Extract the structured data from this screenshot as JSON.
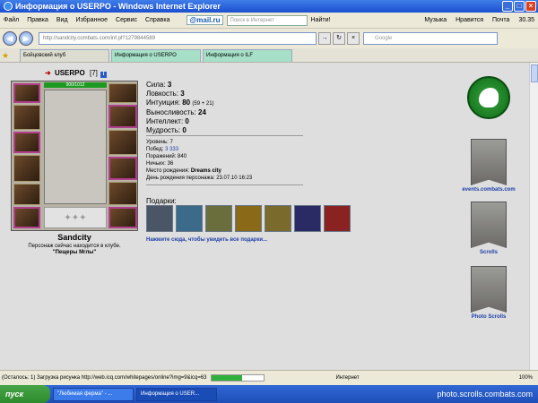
{
  "window": {
    "title": "Информация о USERPO - Windows Internet Explorer"
  },
  "menu": [
    "Файл",
    "Правка",
    "Вид",
    "Избранное",
    "Сервис",
    "Справка"
  ],
  "toolbar": {
    "mailru": "@mail.ru",
    "search_placeholder": "Поиск в Интернет",
    "find": "Найти!",
    "music": "Музыка",
    "like": "Нравится",
    "mail": "Почта",
    "temp": "30.35"
  },
  "address": {
    "url": "http://sandcity.combats.com/inf.pl?1279844589",
    "google_placeholder": "Google"
  },
  "tabs": [
    {
      "label": "Бойцовский клуб"
    },
    {
      "label": "Информация о USERPO"
    },
    {
      "label": "Информация о ILF"
    }
  ],
  "character": {
    "name": "USERPO",
    "level": "[7]",
    "hp": "900/1012",
    "city": "Sandcity",
    "location_text": "Персонаж сейчас находится в клубе.",
    "club": "\"Пещеры Мглы\""
  },
  "stats": [
    {
      "label": "Сила:",
      "value": "3",
      "extra": ""
    },
    {
      "label": "Ловкость:",
      "value": "3",
      "extra": ""
    },
    {
      "label": "Интуиция:",
      "value": "80",
      "extra": "(59 + 21)"
    },
    {
      "label": "Выносливость:",
      "value": "24",
      "extra": ""
    },
    {
      "label": "Интеллект:",
      "value": "0",
      "extra": ""
    },
    {
      "label": "Мудрость:",
      "value": "0",
      "extra": ""
    }
  ],
  "info": {
    "level": "Уровень: 7",
    "wins_label": "Побед:",
    "wins_value": "3 333",
    "losses": "Поражений: 840",
    "draws": "Ничьих: 36",
    "birthplace_label": "Место рождения:",
    "birthplace_value": "Dreams city",
    "birthday": "День рождения персонажа: 23.07.10 16:23"
  },
  "gifts": {
    "title": "Подарки:",
    "link": "Нажмите сюда, чтобы увидеть все подарки...",
    "items": [
      "gift-snowflake",
      "gift-ice",
      "gift-target",
      "gift-bell",
      "gift-candle",
      "gift-card",
      "gift-book"
    ]
  },
  "sidebar": {
    "links": [
      "events.combats.com",
      "Scrolls",
      "Photo Scrolls"
    ]
  },
  "status": {
    "text": "(Осталось: 1) Загрузка рисунка http://web.icq.com/whitepages/online?img=9&icq=63",
    "progress": 0.6,
    "zone": "Интернет",
    "zoom": "100%"
  },
  "taskbar": {
    "start": "пуск",
    "tasks": [
      "\"Любимая ферма\" - ...",
      "Информация о USER..."
    ],
    "watermark": "photo.scrolls.combats.com"
  }
}
